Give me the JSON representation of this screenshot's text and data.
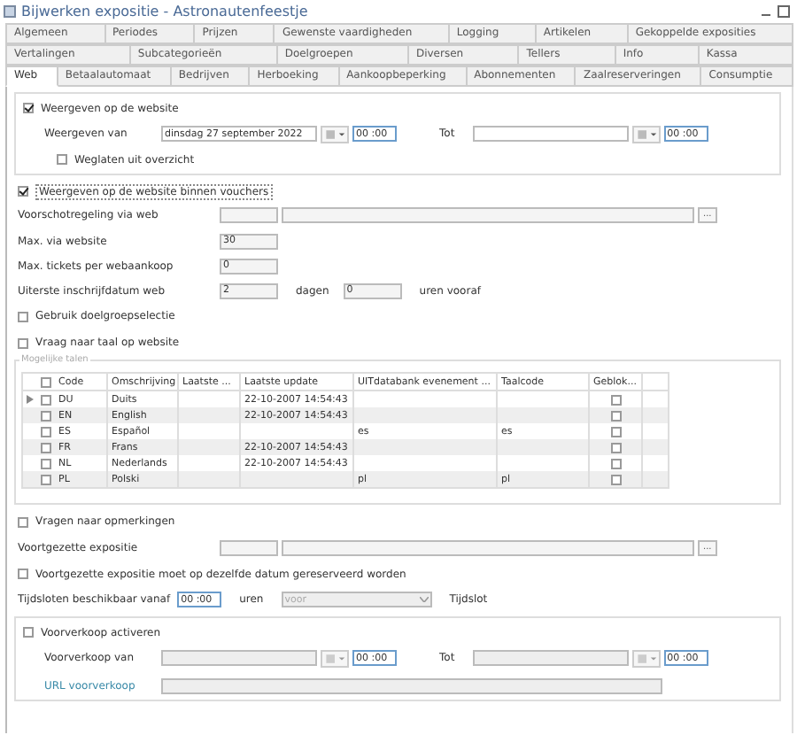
{
  "window": {
    "title": "Bijwerken expositie - Astronautenfeestje"
  },
  "tab_rows": [
    [
      {
        "label": "Algemeen",
        "selected": false
      },
      {
        "label": "Periodes",
        "selected": false
      },
      {
        "label": "Prijzen",
        "selected": false
      },
      {
        "label": "Gewenste vaardigheden",
        "selected": false
      },
      {
        "label": "Logging",
        "selected": false
      },
      {
        "label": "Artikelen",
        "selected": false
      },
      {
        "label": "Gekoppelde exposities",
        "selected": false
      }
    ],
    [
      {
        "label": "Vertalingen",
        "selected": false
      },
      {
        "label": "Subcategorieën",
        "selected": false
      },
      {
        "label": "Doelgroepen",
        "selected": false
      },
      {
        "label": "Diversen",
        "selected": false
      },
      {
        "label": "Tellers",
        "selected": false
      },
      {
        "label": "Info",
        "selected": false
      },
      {
        "label": "Kassa",
        "selected": false
      }
    ],
    [
      {
        "label": "Web",
        "selected": true
      },
      {
        "label": "Betaalautomaat",
        "selected": false
      },
      {
        "label": "Bedrijven",
        "selected": false
      },
      {
        "label": "Herboeking",
        "selected": false
      },
      {
        "label": "Aankoopbeperking",
        "selected": false
      },
      {
        "label": "Abonnementen",
        "selected": false
      },
      {
        "label": "Zaalreserveringen",
        "selected": false
      },
      {
        "label": "Consumptie",
        "selected": false
      }
    ]
  ],
  "web_group": {
    "label": "Weergeven op de website",
    "checked": true,
    "from_label": "Weergeven van",
    "from_date": "dinsdag 27 september 2022",
    "from_time": "00 :00",
    "to_label": "Tot",
    "to_time": "00 :00",
    "omit_label": "Weglaten uit overzicht",
    "omit_checked": false
  },
  "vouchers": {
    "label": "Weergeven op de website binnen vouchers",
    "checked": true
  },
  "advance": {
    "label": "Voorschotregeling via web",
    "button": "..."
  },
  "max_web": {
    "label": "Max. via website",
    "value": "30"
  },
  "max_tickets": {
    "label": "Max. tickets per webaankoop",
    "value": "0"
  },
  "deadline": {
    "label": "Uiterste inschrijfdatum web",
    "days": "2",
    "days_label": "dagen",
    "hours": "0",
    "hours_label": "uren vooraf"
  },
  "target_group": {
    "label": "Gebruik doelgroepselectie",
    "checked": false
  },
  "ask_language": {
    "label": "Vraag naar taal op website",
    "checked": false
  },
  "languages": {
    "title": "Mogelijke talen",
    "header_checked": false,
    "columns": [
      "Code",
      "Omschrijving",
      "Laatste ...",
      "Laatste update",
      "UITdatabank evenement ...",
      "Taalcode",
      "Geblok..."
    ],
    "rows": [
      {
        "current": true,
        "checked": false,
        "code": "DU",
        "description": "Duits",
        "updated": "22-10-2007 14:54:43",
        "blocked": false
      },
      {
        "current": false,
        "checked": false,
        "code": "EN",
        "description": "English",
        "updated": "22-10-2007 14:54:43",
        "blocked": false
      },
      {
        "current": false,
        "checked": false,
        "code": "ES",
        "description": "Español",
        "uit": "es",
        "lang": "es",
        "blocked": false
      },
      {
        "current": false,
        "checked": false,
        "code": "FR",
        "description": "Frans",
        "updated": "22-10-2007 14:54:43",
        "blocked": false
      },
      {
        "current": false,
        "checked": false,
        "code": "NL",
        "description": "Nederlands",
        "updated": "22-10-2007 14:54:43",
        "blocked": false
      },
      {
        "current": false,
        "checked": false,
        "code": "PL",
        "description": "Polski",
        "uit": "pl",
        "lang": "pl",
        "blocked": false
      }
    ]
  },
  "remarks": {
    "label": "Vragen naar opmerkingen",
    "checked": false
  },
  "continued": {
    "label": "Voortgezette expositie",
    "button": "..."
  },
  "same_date": {
    "label": "Voortgezette expositie moet op dezelfde datum gereserveerd worden",
    "checked": false
  },
  "timeslots": {
    "label": "Tijdsloten beschikbaar vanaf",
    "time": "00 :00",
    "unit": "uren",
    "select": "voor",
    "suffix": "Tijdslot"
  },
  "presale": {
    "label": "Voorverkoop activeren",
    "checked": false,
    "from_label": "Voorverkoop van",
    "from_time": "00 :00",
    "to_label": "Tot",
    "to_time": "00 :00",
    "url_label": "URL voorverkoop"
  }
}
